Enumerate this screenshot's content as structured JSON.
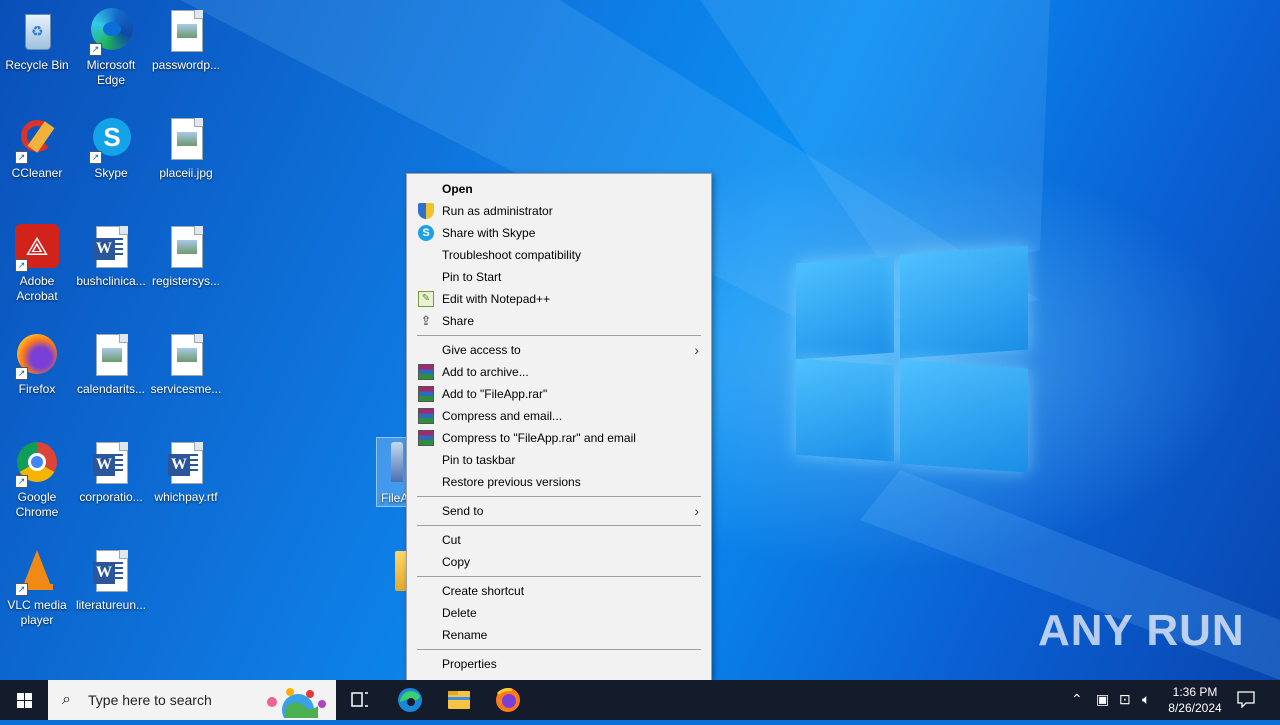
{
  "desktop_icons": [
    {
      "name": "Recycle Bin",
      "icon": "recycle-bin-icon"
    },
    {
      "name": "Microsoft Edge",
      "icon": "edge-icon"
    },
    {
      "name": "passwordp...",
      "icon": "image-file-icon"
    },
    {
      "name": "CCleaner",
      "icon": "ccleaner-icon"
    },
    {
      "name": "Skype",
      "icon": "skype-icon"
    },
    {
      "name": "placeii.jpg",
      "icon": "image-file-icon"
    },
    {
      "name": "Adobe Acrobat",
      "icon": "acrobat-icon"
    },
    {
      "name": "bushclinica...",
      "icon": "word-doc-icon"
    },
    {
      "name": "registersys...",
      "icon": "image-file-icon"
    },
    {
      "name": "Firefox",
      "icon": "firefox-icon"
    },
    {
      "name": "calendarits...",
      "icon": "image-file-icon"
    },
    {
      "name": "servicesme...",
      "icon": "image-file-icon"
    },
    {
      "name": "Google Chrome",
      "icon": "chrome-icon"
    },
    {
      "name": "corporatio...",
      "icon": "word-doc-icon"
    },
    {
      "name": "whichpay.rtf",
      "icon": "word-doc-icon"
    },
    {
      "name": "VLC media player",
      "icon": "vlc-icon"
    },
    {
      "name": "literatureun...",
      "icon": "word-doc-icon"
    }
  ],
  "selected_file": {
    "label": "FileA"
  },
  "context_menu": {
    "items": [
      {
        "label": "Open",
        "bold": true
      },
      {
        "label": "Run as administrator",
        "icon": "uac-shield-icon"
      },
      {
        "label": "Share with Skype",
        "icon": "skype-icon"
      },
      {
        "label": "Troubleshoot compatibility"
      },
      {
        "label": "Pin to Start"
      },
      {
        "label": "Edit with Notepad++",
        "icon": "notepadpp-icon"
      },
      {
        "label": "Share",
        "icon": "share-icon"
      },
      {
        "label": "Give access to",
        "submenu": true
      },
      {
        "label": "Add to archive...",
        "icon": "winrar-icon"
      },
      {
        "label": "Add to \"FileApp.rar\"",
        "icon": "winrar-icon"
      },
      {
        "label": "Compress and email...",
        "icon": "winrar-icon"
      },
      {
        "label": "Compress to \"FileApp.rar\" and email",
        "icon": "winrar-icon"
      },
      {
        "label": "Pin to taskbar"
      },
      {
        "label": "Restore previous versions"
      },
      {
        "label": "Send to",
        "submenu": true
      },
      {
        "label": "Cut"
      },
      {
        "label": "Copy"
      },
      {
        "label": "Create shortcut"
      },
      {
        "label": "Delete"
      },
      {
        "label": "Rename"
      },
      {
        "label": "Properties"
      }
    ]
  },
  "taskbar": {
    "search_placeholder": "Type here to search",
    "pinned": [
      "task-view-icon",
      "edge-icon",
      "file-explorer-icon",
      "firefox-icon"
    ],
    "clock_time": "1:36 PM",
    "clock_date": "8/26/2024"
  },
  "watermark": "ANY RUN",
  "colors": {
    "menu_bg": "#f2f2f2",
    "taskbar_bg": "#141b2b",
    "desktop_accent": "#0a78e0"
  }
}
